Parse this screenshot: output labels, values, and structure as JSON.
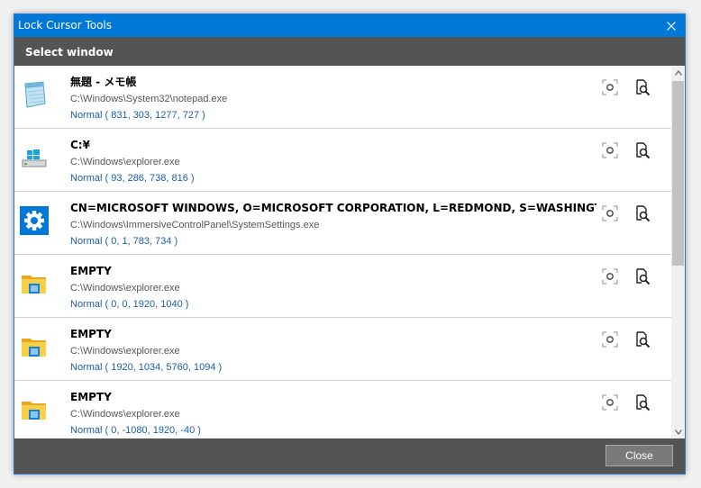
{
  "window": {
    "title": "Lock Cursor Tools",
    "accent_color": "#0078d7",
    "close_icon": "close-icon"
  },
  "header": {
    "title": "Select window"
  },
  "rows": [
    {
      "icon": "notepad-icon",
      "title": "無題 - メモ帳",
      "path": "C:\\Windows\\System32\\notepad.exe",
      "rect": "Normal ( 831, 303, 1277, 727 )"
    },
    {
      "icon": "drive-icon",
      "title": "C:¥",
      "path": "C:\\Windows\\explorer.exe",
      "rect": "Normal ( 93, 286, 738, 816 )"
    },
    {
      "icon": "settings-gear-icon",
      "title": "CN=MICROSOFT WINDOWS, O=MICROSOFT CORPORATION, L=REDMOND, S=WASHINGTON, C=US",
      "path": "C:\\Windows\\ImmersiveControlPanel\\SystemSettings.exe",
      "rect": "Normal ( 0, 1, 783, 734 )"
    },
    {
      "icon": "folder-explorer-icon",
      "title": "EMPTY",
      "path": "C:\\Windows\\explorer.exe",
      "rect": "Normal ( 0, 0, 1920, 1040 )"
    },
    {
      "icon": "folder-explorer-icon",
      "title": "EMPTY",
      "path": "C:\\Windows\\explorer.exe",
      "rect": "Normal ( 1920, 1034, 5760, 1094 )"
    },
    {
      "icon": "folder-explorer-icon",
      "title": "EMPTY",
      "path": "C:\\Windows\\explorer.exe",
      "rect": "Normal ( 0, -1080, 1920, -40 )"
    }
  ],
  "footer": {
    "close_label": "Close"
  }
}
